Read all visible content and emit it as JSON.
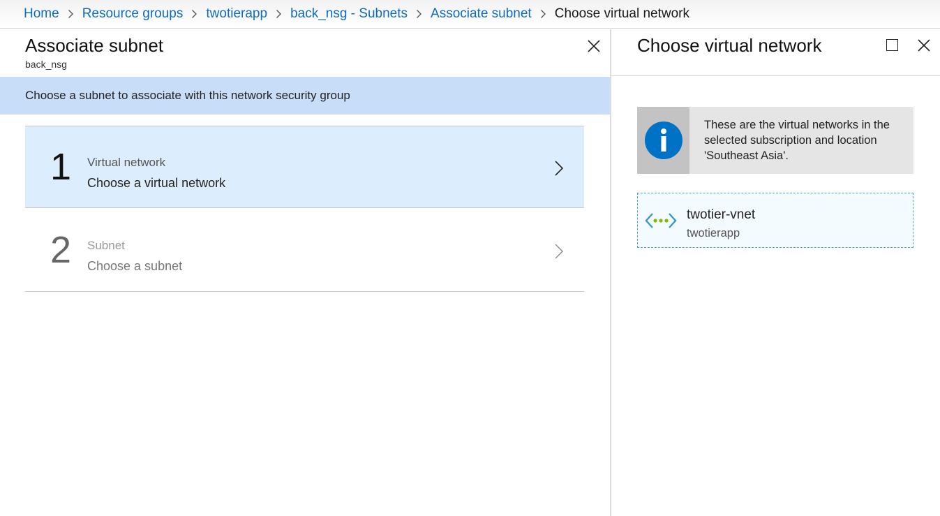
{
  "breadcrumb": {
    "items": [
      {
        "label": "Home"
      },
      {
        "label": "Resource groups"
      },
      {
        "label": "twotierapp"
      },
      {
        "label": "back_nsg - Subnets"
      },
      {
        "label": "Associate subnet"
      }
    ],
    "current": "Choose virtual network"
  },
  "left_blade": {
    "title": "Associate subnet",
    "subtitle": "back_nsg",
    "banner": "Choose a subnet to associate with this network security group",
    "steps": [
      {
        "number": "1",
        "label": "Virtual network",
        "value": "Choose a virtual network",
        "state": "active"
      },
      {
        "number": "2",
        "label": "Subnet",
        "value": "Choose a subnet",
        "state": "disabled"
      }
    ]
  },
  "right_blade": {
    "title": "Choose virtual network",
    "notice": "These are the virtual networks in the selected subscription and location 'Southeast Asia'.",
    "vnets": [
      {
        "name": "twotier-vnet",
        "resource_group": "twotierapp",
        "icon": "virtual-network-icon"
      }
    ]
  },
  "colors": {
    "link": "#0f6cbd",
    "banner": "#c7ddf8",
    "active_step": "#dcedfd",
    "info_icon": "#0072c6",
    "vnet_border": "#45a6c2",
    "vnet_dots": "#7fba00"
  }
}
